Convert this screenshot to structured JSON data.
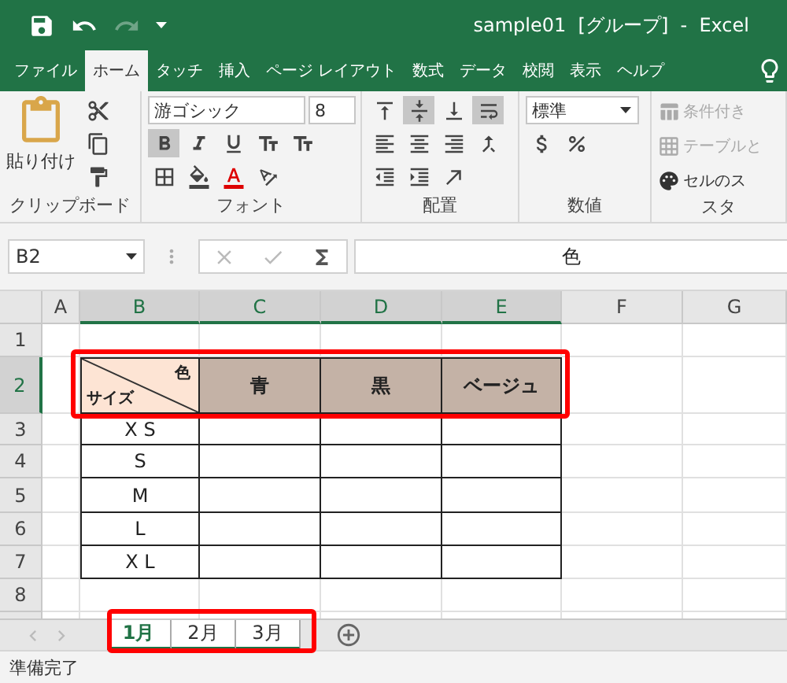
{
  "title_bar": {
    "title": "sample01  [グループ]  -  Excel"
  },
  "ribbon_tabs": [
    {
      "label": "ファイル",
      "selected": false
    },
    {
      "label": "ホーム",
      "selected": true
    },
    {
      "label": "タッチ",
      "selected": false
    },
    {
      "label": "挿入",
      "selected": false
    },
    {
      "label": "ページ レイアウト",
      "selected": false
    },
    {
      "label": "数式",
      "selected": false
    },
    {
      "label": "データ",
      "selected": false
    },
    {
      "label": "校閲",
      "selected": false
    },
    {
      "label": "表示",
      "selected": false
    },
    {
      "label": "ヘルプ",
      "selected": false
    }
  ],
  "ribbon": {
    "groups": [
      {
        "kind": "clipboard",
        "label": "クリップボード",
        "paste": "貼り付け"
      },
      {
        "kind": "font",
        "label": "フォント",
        "font_name": "游ゴシック",
        "font_size": "8",
        "bold": true
      },
      {
        "kind": "alignment",
        "label": "配置",
        "middle_align": true,
        "wrap_text": true
      },
      {
        "kind": "number",
        "label": "数値",
        "format": "標準"
      },
      {
        "kind": "styles",
        "label": "スタ",
        "items": [
          "条件付き",
          "テーブルと",
          "セルのス"
        ]
      }
    ]
  },
  "formula_bar": {
    "name_box": "B2",
    "formula": "色"
  },
  "columns": [
    {
      "label": "A",
      "selected": false
    },
    {
      "label": "B",
      "selected": true
    },
    {
      "label": "C",
      "selected": true
    },
    {
      "label": "D",
      "selected": true
    },
    {
      "label": "E",
      "selected": true
    },
    {
      "label": "F",
      "selected": false
    },
    {
      "label": "G",
      "selected": false
    }
  ],
  "rows": [
    {
      "label": "1",
      "selected": false
    },
    {
      "label": "2",
      "selected": true
    },
    {
      "label": "3",
      "selected": false
    },
    {
      "label": "4",
      "selected": false
    },
    {
      "label": "5",
      "selected": false
    },
    {
      "label": "6",
      "selected": false
    },
    {
      "label": "7",
      "selected": false
    },
    {
      "label": "8",
      "selected": false
    }
  ],
  "table": {
    "highlighted": true,
    "corner": {
      "top": "色",
      "bottom": "サイズ"
    },
    "colors": [
      "青",
      "黒",
      "ベージュ"
    ],
    "sizes": [
      "X S",
      "S",
      "M",
      "L",
      "X L"
    ]
  },
  "sheet_tabs_highlighted": true,
  "sheet_tabs": [
    {
      "label": "1月",
      "selected": true
    },
    {
      "label": "2月",
      "selected": false
    },
    {
      "label": "3月",
      "selected": false
    }
  ],
  "status_bar": {
    "text": "準備完了"
  }
}
